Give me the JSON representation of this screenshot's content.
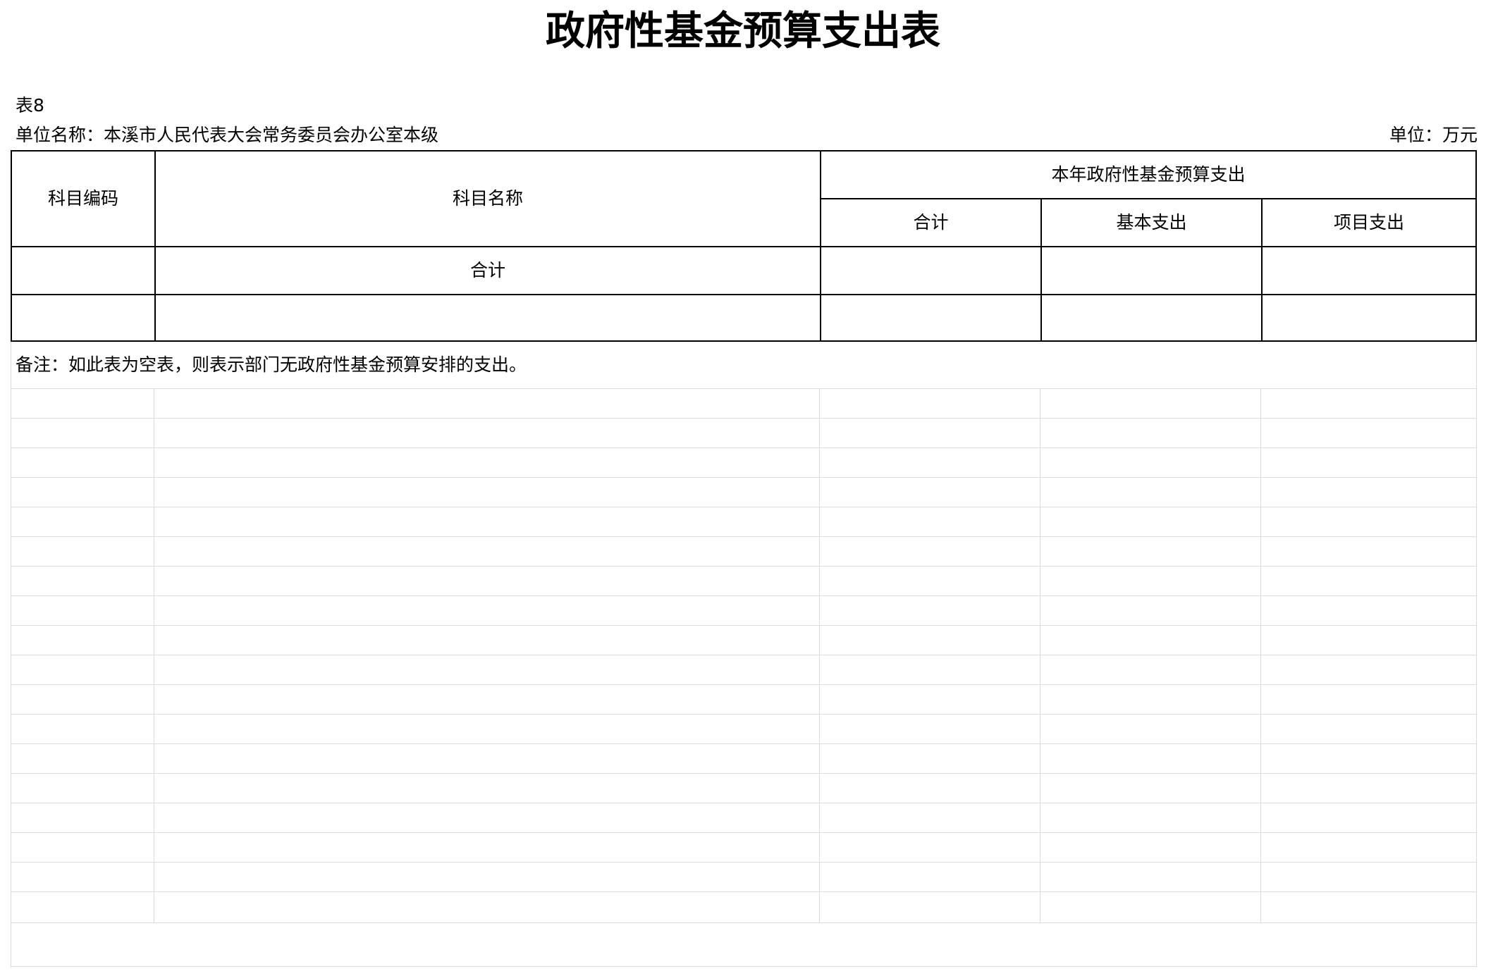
{
  "document": {
    "title": "政府性基金预算支出表",
    "table_no": "表8",
    "unit_name": "单位名称：本溪市人民代表大会常务委员会办公室本级",
    "unit": "单位：万元",
    "note": "备注：如此表为空表，则表示部门无政府性基金预算安排的支出。"
  },
  "table": {
    "headers": {
      "code": "科目编码",
      "name": "科目名称",
      "group": "本年政府性基金预算支出",
      "total": "合计",
      "basic": "基本支出",
      "project": "项目支出"
    },
    "rows": [
      {
        "code": "",
        "name": "合计",
        "total": "",
        "basic": "",
        "project": ""
      },
      {
        "code": "",
        "name": "",
        "total": "",
        "basic": "",
        "project": ""
      }
    ]
  },
  "colors": {
    "border": "#000000",
    "grid": "#dcdcdc"
  }
}
